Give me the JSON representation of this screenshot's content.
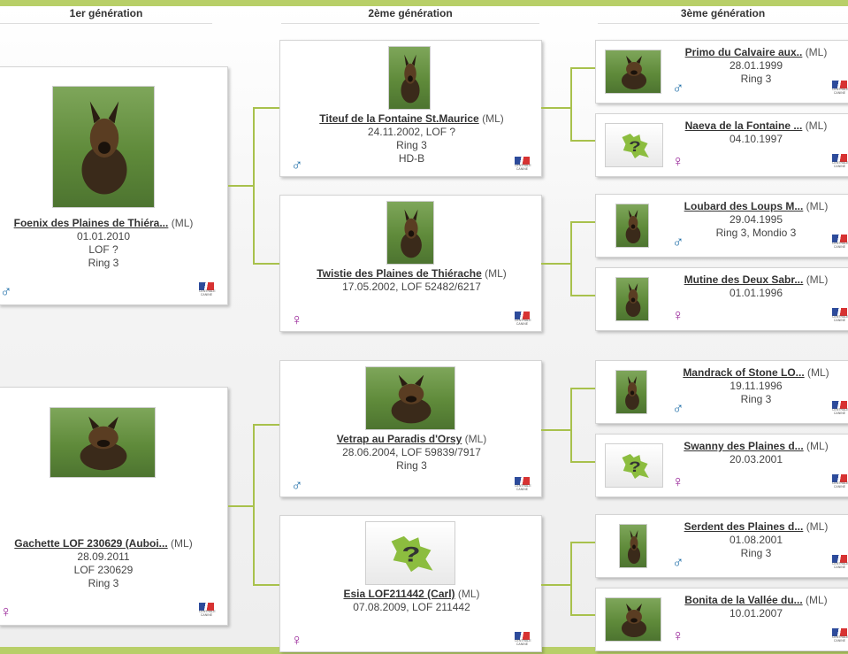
{
  "headers": [
    "1er génération",
    "2ème génération",
    "3ème génération"
  ],
  "ml": "(ML)",
  "symbols": {
    "male": "♂",
    "female": "♀",
    "unknown": "?"
  },
  "flag_text": "CENTRALE CANINE",
  "colors": {
    "accent": "#b8cf68",
    "connector": "#a8c14c",
    "male": "#1e6ea8",
    "female": "#9b2a9b"
  },
  "gen1": [
    {
      "name": "Foenix des Plaines de Thiéra...",
      "lines": [
        "01.01.2010",
        "LOF ?",
        "Ring 3"
      ],
      "sex": "male"
    },
    {
      "name": "Gachette LOF 230629 (Auboi...",
      "lines": [
        "28.09.2011",
        "LOF 230629",
        "Ring 3"
      ],
      "sex": "female"
    }
  ],
  "gen2": [
    {
      "name": "Titeuf de la Fontaine St.Maurice",
      "lines": [
        "24.11.2002, LOF ?",
        "Ring 3",
        "HD-B"
      ],
      "sex": "male"
    },
    {
      "name": "Twistie des Plaines de Thiérache",
      "lines": [
        "17.05.2002, LOF 52482/6217"
      ],
      "sex": "female"
    },
    {
      "name": "Vetrap au Paradis d'Orsy",
      "lines": [
        "28.06.2004, LOF 59839/7917",
        "Ring 3"
      ],
      "sex": "male"
    },
    {
      "name": "Esia LOF211442 (Carl)",
      "lines": [
        "07.08.2009, LOF 211442"
      ],
      "sex": "female"
    }
  ],
  "gen3": [
    {
      "name": "Primo du Calvaire aux..",
      "lines": [
        "28.01.1999",
        "Ring 3"
      ],
      "sex": "male"
    },
    {
      "name": "Naeva de la Fontaine ...",
      "lines": [
        "04.10.1997"
      ],
      "sex": "female"
    },
    {
      "name": "Loubard des Loups M...",
      "lines": [
        "29.04.1995",
        "Ring 3, Mondio 3"
      ],
      "sex": "male"
    },
    {
      "name": "Mutine des Deux Sabr...",
      "lines": [
        "01.01.1996"
      ],
      "sex": "female"
    },
    {
      "name": "Mandrack of Stone LO...",
      "lines": [
        "19.11.1996",
        "Ring 3"
      ],
      "sex": "male"
    },
    {
      "name": "Swanny des Plaines d...",
      "lines": [
        "20.03.2001"
      ],
      "sex": "female"
    },
    {
      "name": "Serdent des Plaines d...",
      "lines": [
        "01.08.2001",
        "Ring 3"
      ],
      "sex": "male"
    },
    {
      "name": "Bonita de la Vallée du...",
      "lines": [
        "10.01.2007"
      ],
      "sex": "female"
    }
  ]
}
